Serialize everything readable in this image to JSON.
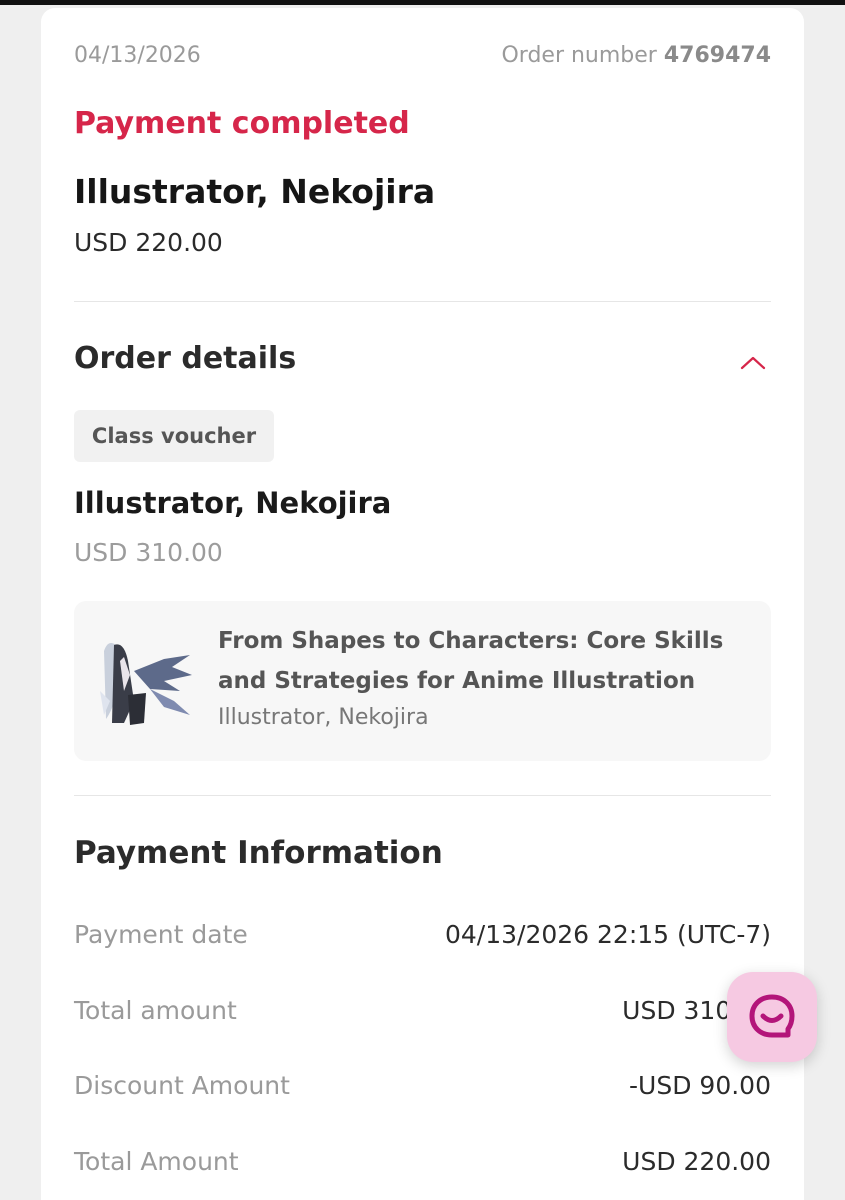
{
  "header": {
    "date": "04/13/2026",
    "order_label": "Order number",
    "order_number": "4769474"
  },
  "summary": {
    "status": "Payment completed",
    "seller": "Illustrator, Nekojira",
    "price": "USD 220.00"
  },
  "order_details": {
    "title": "Order details",
    "toggle_icon": "chevron-up-icon",
    "chip": "Class voucher",
    "seller": "Illustrator, Nekojira",
    "price": "USD 310.00",
    "course": {
      "title": "From Shapes to Characters: Core Skills and Strategies for Anime Illustration",
      "author": "Illustrator, Nekojira"
    }
  },
  "payment_info": {
    "title": "Payment Information",
    "rows": [
      {
        "label": "Payment date",
        "value": "04/13/2026 22:15 (UTC-7)"
      },
      {
        "label": "Total amount",
        "value": "USD 310.00"
      },
      {
        "label": "Discount Amount",
        "value": "-USD 90.00"
      },
      {
        "label": "Total Amount",
        "value": "USD 220.00"
      }
    ]
  },
  "colors": {
    "accent": "#d6264a",
    "chat_bg": "#f6c9e2",
    "chat_icon": "#b3157a"
  },
  "chat_button": {
    "icon": "chat-smile-icon"
  }
}
